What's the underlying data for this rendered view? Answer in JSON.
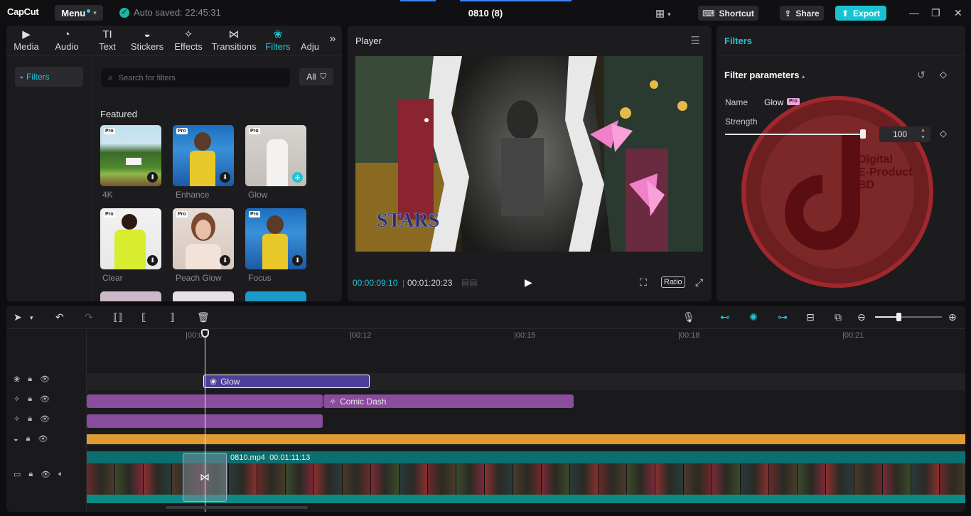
{
  "app": {
    "logo": "CapCut",
    "menu_label": "Menu",
    "autosave": "Auto saved: 22:45:31",
    "project_title": "0810 (8)",
    "shortcut_label": "Shortcut",
    "share_label": "Share",
    "export_label": "Export"
  },
  "tabs": [
    {
      "label": "Media",
      "icon": "media-icon"
    },
    {
      "label": "Audio",
      "icon": "audio-icon"
    },
    {
      "label": "Text",
      "icon": "text-icon"
    },
    {
      "label": "Stickers",
      "icon": "stickers-icon"
    },
    {
      "label": "Effects",
      "icon": "effects-icon"
    },
    {
      "label": "Transitions",
      "icon": "transitions-icon"
    },
    {
      "label": "Filters",
      "icon": "filters-icon",
      "active": true
    },
    {
      "label": "Adju",
      "icon": "adjust-icon"
    }
  ],
  "side_nav": {
    "filters_label": "Filters"
  },
  "search": {
    "placeholder": "Search for filters"
  },
  "all_button": "All",
  "featured_label": "Featured",
  "filter_cards": [
    {
      "label": "4K",
      "pro": "Pro",
      "action": "download"
    },
    {
      "label": "Enhance",
      "pro": "Pro",
      "action": "download"
    },
    {
      "label": "Glow",
      "pro": "Pro",
      "action": "add"
    },
    {
      "label": "Clear",
      "pro": "Pro",
      "action": "download"
    },
    {
      "label": "Peach Glow",
      "pro": "Pro",
      "action": "download"
    },
    {
      "label": "Focus",
      "pro": "Pro",
      "action": "download"
    }
  ],
  "player": {
    "title": "Player",
    "current_time": "00:00:09:10",
    "total_time": "00:01:20:23",
    "ratio_label": "Ratio",
    "overlay_text": "STARS"
  },
  "right_panel": {
    "title": "Filters",
    "section_title": "Filter parameters",
    "name_label": "Name",
    "name_value": "Glow",
    "pro_badge": "Pro",
    "strength_label": "Strength",
    "strength_value": "100",
    "strength_fraction": 1.0,
    "watermark_lines": [
      "Digital",
      "E-Product",
      "BD"
    ]
  },
  "timeline": {
    "ticks": [
      "|00:09",
      "|00:12",
      "|00:15",
      "|00:18",
      "|00:21"
    ],
    "glow_clip": "Glow",
    "comic_clip": "Comic Dash",
    "video_name": "0810.mp4",
    "video_duration": "00:01:11:13",
    "zoom_fraction": 0.36
  },
  "colors": {
    "accent": "#22c3d6",
    "glow_clip": "#4b3f99",
    "effect_clip": "#8a4c9c",
    "orange_track": "#e09a32",
    "video_track": "#0c6e6e"
  }
}
